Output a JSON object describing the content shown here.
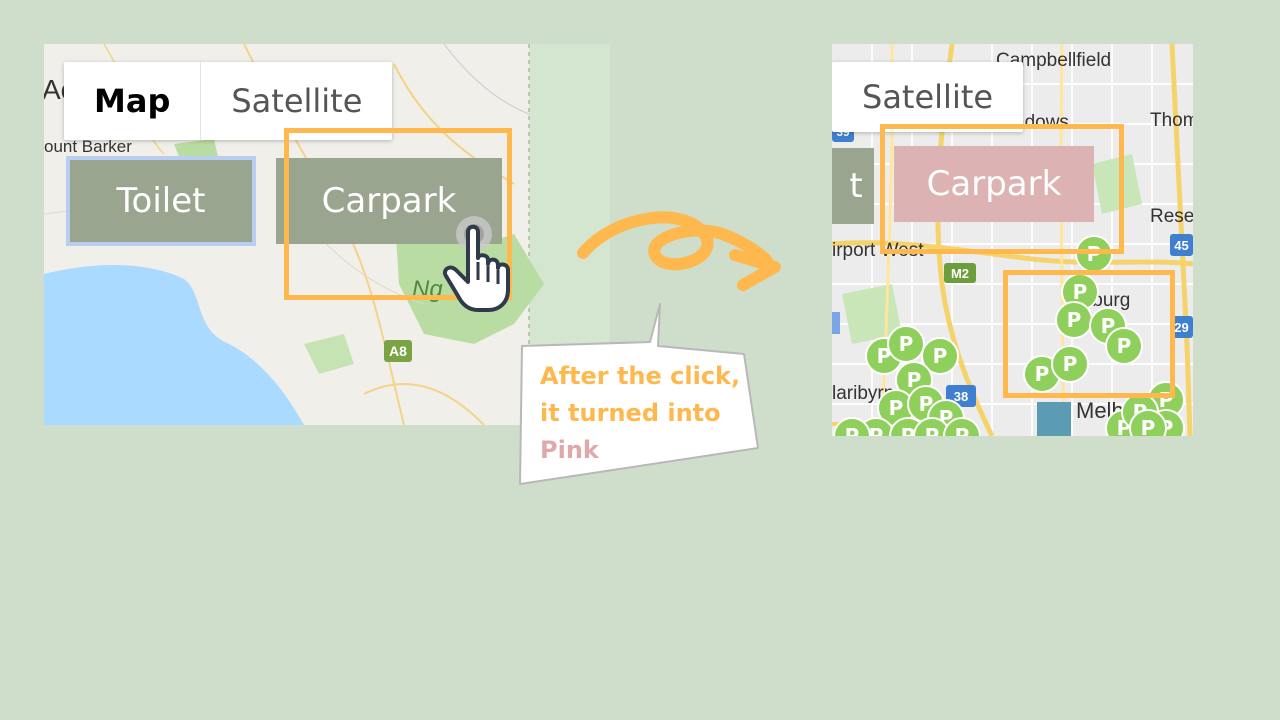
{
  "before": {
    "map_type": {
      "map_label": "Map",
      "satellite_label": "Satellite"
    },
    "buttons": {
      "toilet_label": "Toilet",
      "carpark_label": "Carpark"
    },
    "labels": {
      "place_1": "Ac",
      "place_2": "ount Barker",
      "place_3": "Ng",
      "route_badge": "A8"
    }
  },
  "after": {
    "map_type": {
      "satellite_label": "Satellite"
    },
    "buttons": {
      "toilet_partial": "t",
      "carpark_label": "Carpark",
      "carpark_state": "pink"
    },
    "labels": {
      "campbellfield": "Campbellfield",
      "meadows": "adows",
      "thomastown": "Thom",
      "reservoir": "Rese",
      "airport_west": "irport West",
      "coburg": "Coburg",
      "maribyrnong": "laribyrn",
      "melbourne": "Melbou",
      "route_m2": "M2",
      "route_38": "38",
      "route_45": "45",
      "route_29": "29",
      "route_39": "39"
    },
    "parking_marker_glyph": "P",
    "parking_marker_count": 24
  },
  "callout": {
    "line1": "After the click,",
    "line2": "it turned into",
    "line3": "Pink"
  },
  "colors": {
    "background": "#cfdeca",
    "highlight": "#ffb84d",
    "button_grey": "#9aa590",
    "button_pink": "#dcb2b2",
    "parking_marker": "#8fcf5b",
    "water": "#aadaff"
  }
}
